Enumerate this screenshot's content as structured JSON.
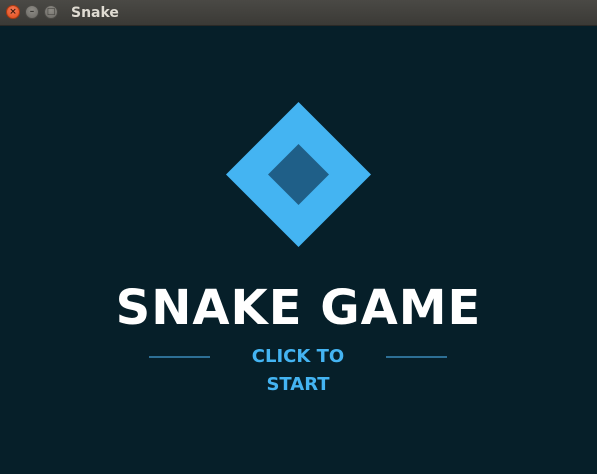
{
  "window": {
    "title": "Snake",
    "close_glyph": "×",
    "minimize_glyph": "–",
    "maximize_glyph": "□"
  },
  "game": {
    "title": "SNAKE GAME",
    "start_label": "CLICK TO START"
  },
  "icons": {
    "logo": "diamond-logo-icon"
  },
  "colors": {
    "background": "#061f29",
    "accent": "#44b4f2",
    "logo_inner": "#1f5f88",
    "title_text": "#ffffff",
    "rule": "#2d6f95"
  }
}
